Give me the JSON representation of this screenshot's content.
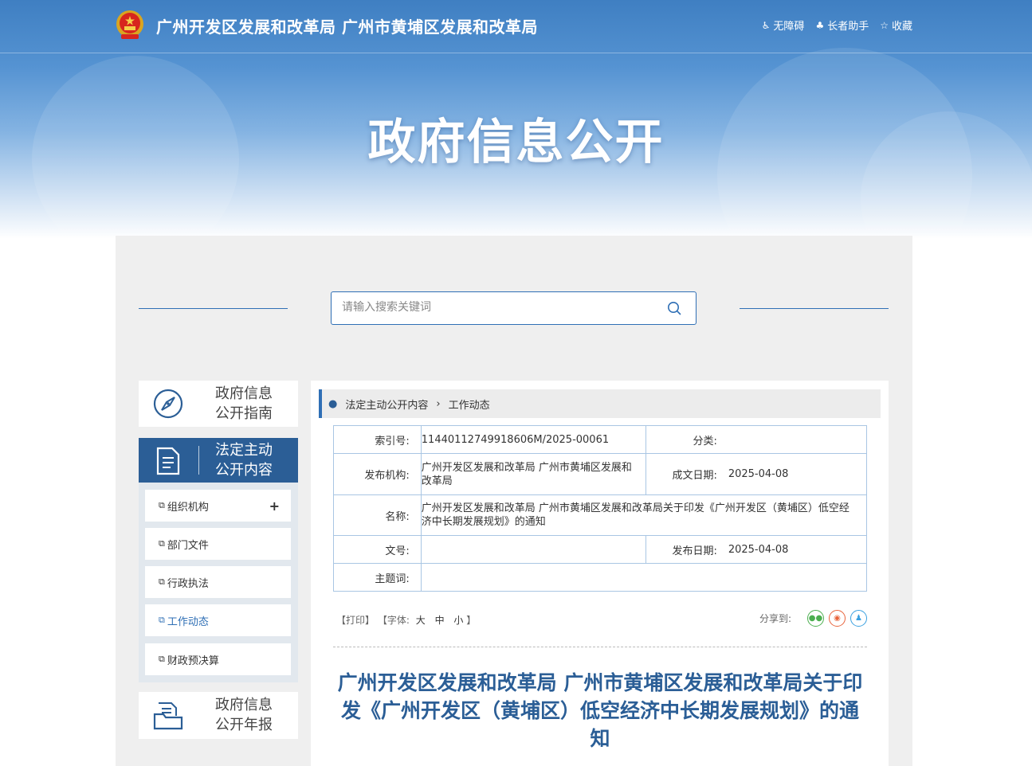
{
  "header": {
    "site_title": "广州开发区发展和改革局 广州市黄埔区发展和改革局",
    "links": [
      {
        "label": "无障碍",
        "icon": "accessibility-icon"
      },
      {
        "label": "长者助手",
        "icon": "elder-helper-icon"
      },
      {
        "label": "收藏",
        "icon": "star-icon"
      }
    ],
    "hero_title": "政府信息公开"
  },
  "search": {
    "placeholder": "请输入搜索关键词"
  },
  "sidebar": {
    "guide": {
      "line1": "政府信息",
      "line2": "公开指南",
      "icon": "compass-icon"
    },
    "active": {
      "line1": "法定主动",
      "line2": "公开内容",
      "icon": "document-icon"
    },
    "items": [
      {
        "label": "组织机构",
        "expand": "+"
      },
      {
        "label": "部门文件"
      },
      {
        "label": "行政执法"
      },
      {
        "label": "工作动态"
      },
      {
        "label": "财政预决算"
      }
    ],
    "annual": {
      "line1": "政府信息",
      "line2": "公开年报",
      "icon": "folder-icon"
    }
  },
  "breadcrumb": {
    "parent": "法定主动公开内容",
    "current": "工作动态"
  },
  "meta": {
    "index_key": "索引号:",
    "index_val": "11440112749918606M/2025-00061",
    "category_key": "分类:",
    "category_val": "",
    "publisher_key": "发布机构:",
    "publisher_val": "广州开发区发展和改革局 广州市黄埔区发展和改革局",
    "created_key": "成文日期:",
    "created_val": "2025-04-08",
    "name_key": "名称:",
    "name_val": "广州开发区发展和改革局 广州市黄埔区发展和改革局关于印发《广州开发区（黄埔区）低空经济中长期发展规划》的通知",
    "docno_key": "文号:",
    "docno_val": "",
    "published_key": "发布日期:",
    "published_val": "2025-04-08",
    "topic_key": "主题词:",
    "topic_val": ""
  },
  "tools": {
    "print": "【打印】",
    "font_prefix": "【字体:",
    "font_large": "大",
    "font_medium": "中",
    "font_small": "小",
    "font_suffix": "】",
    "share_label": "分享到:"
  },
  "document": {
    "title": "广州开发区发展和改革局 广州市黄埔区发展和改革局关于印发《广州开发区（黄埔区）低空经济中长期发展规划》的通知"
  },
  "colors": {
    "primary": "#2b5e96",
    "accent": "#2f6fb5",
    "wechat": "#4caf50",
    "weibo": "#e8643c",
    "qq": "#3aa0e0"
  }
}
